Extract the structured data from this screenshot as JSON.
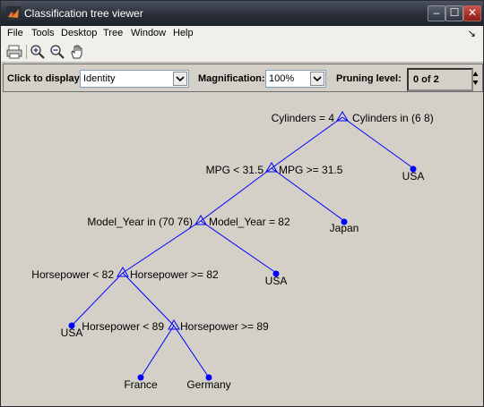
{
  "window": {
    "title": "Classification tree viewer",
    "minimize": "–",
    "maximize": "☐",
    "close": "✕"
  },
  "menu": [
    "File",
    "Tools",
    "Desktop",
    "Tree",
    "Window",
    "Help"
  ],
  "menu_dock_glyph": "↘",
  "toolbar": {
    "buttons": [
      "print-icon",
      "zoom-in-icon",
      "zoom-out-icon",
      "pan-hand-icon"
    ]
  },
  "controls": {
    "display_label": "Click to display:",
    "display_value": "Identity",
    "magnification_label": "Magnification:",
    "magnification_value": "100%",
    "pruning_label": "Pruning level:",
    "pruning_value": "0 of 2"
  },
  "tree": {
    "colors": {
      "line": "#0000ff",
      "node": "#0000ff"
    },
    "labels": {
      "n1_left": "Cylinders = 4",
      "n1_right": "Cylinders in (6 8)",
      "n2_left": "MPG < 31.5",
      "n2_right": "MPG >= 31.5",
      "n3_left": "Model_Year in (70 76)",
      "n3_right": "Model_Year = 82",
      "n4_left": "Horsepower < 82",
      "n4_right": "Horsepower >= 82",
      "n5_left": "Horsepower < 89",
      "n5_right": "Horsepower >= 89"
    },
    "leaves": {
      "usa1": "USA",
      "japan": "Japan",
      "usa2": "USA",
      "usa3": "USA",
      "france": "France",
      "germany": "Germany"
    }
  }
}
